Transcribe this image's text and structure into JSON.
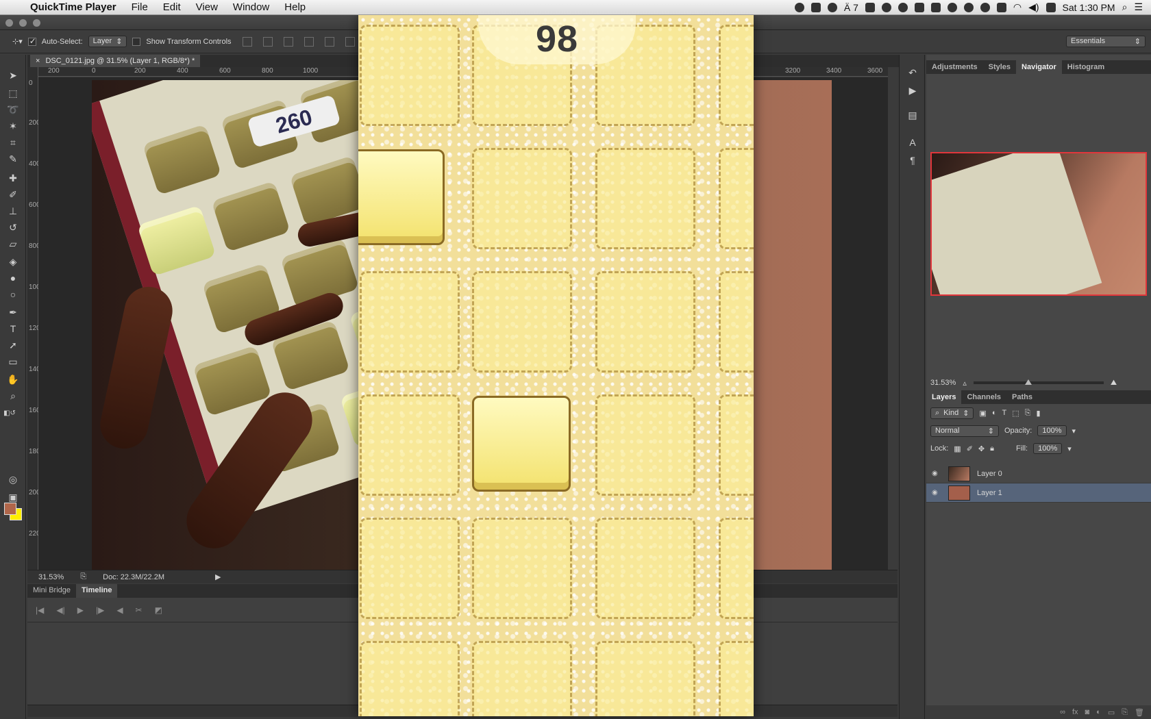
{
  "menubar": {
    "app_name": "QuickTime Player",
    "menus": [
      "File",
      "Edit",
      "View",
      "Window",
      "Help"
    ],
    "status_badge_text": "7",
    "clock": "Sat 1:30 PM"
  },
  "options_bar": {
    "auto_select_label": "Auto-Select:",
    "auto_select_value": "Layer",
    "show_transform_label": "Show Transform Controls",
    "workspace": "Essentials"
  },
  "document": {
    "tab_title": "DSC_0121.jpg @ 31.5% (Layer 1, RGB/8*) *",
    "zoom": "31.53%",
    "doc_size": "Doc: 22.3M/22.2M",
    "image_score": "260"
  },
  "rulers": {
    "top_ticks": [
      "200",
      "0",
      "200",
      "400",
      "600",
      "800",
      "1000",
      "3200",
      "3400",
      "3600"
    ],
    "left_ticks": [
      "0",
      "200",
      "400",
      "600",
      "800",
      "1000",
      "1200",
      "1400",
      "1600",
      "1800",
      "2000",
      "2200"
    ]
  },
  "bottom_panel": {
    "tabs": [
      "Mini Bridge",
      "Timeline"
    ],
    "active_tab": "Timeline"
  },
  "right_panel": {
    "top_tabs": [
      "Adjustments",
      "Styles",
      "Navigator",
      "Histogram"
    ],
    "active_top_tab": "Navigator",
    "navigator_zoom": "31.53%",
    "layer_tabs": [
      "Layers",
      "Channels",
      "Paths"
    ],
    "active_layer_tab": "Layers",
    "kind_filter": "Kind",
    "blend_mode": "Normal",
    "opacity_label": "Opacity:",
    "opacity_value": "100%",
    "lock_label": "Lock:",
    "fill_label": "Fill:",
    "fill_value": "100%",
    "layers": [
      {
        "name": "Layer 0",
        "selected": false
      },
      {
        "name": "Layer 1",
        "selected": true
      }
    ]
  },
  "quicktime": {
    "score": "98"
  },
  "colors": {
    "foreground": "#b0664a",
    "background": "#ffee00",
    "selection_highlight": "#56647a",
    "navigator_box": "#e2363b"
  }
}
